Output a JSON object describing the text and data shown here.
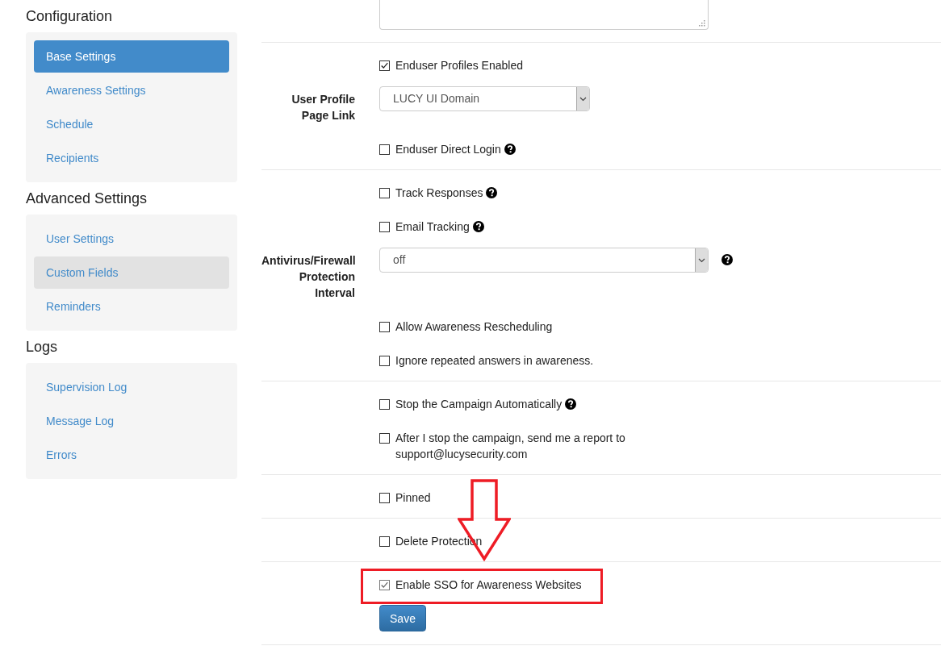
{
  "sidebar": {
    "groups": [
      {
        "title": "Configuration",
        "items": [
          {
            "label": "Base Settings",
            "selected": true,
            "hovered": false
          },
          {
            "label": "Awareness Settings",
            "selected": false,
            "hovered": false
          },
          {
            "label": "Schedule",
            "selected": false,
            "hovered": false
          },
          {
            "label": "Recipients",
            "selected": false,
            "hovered": false
          }
        ]
      },
      {
        "title": "Advanced Settings",
        "items": [
          {
            "label": "User Settings",
            "selected": false,
            "hovered": false
          },
          {
            "label": "Custom Fields",
            "selected": false,
            "hovered": true
          },
          {
            "label": "Reminders",
            "selected": false,
            "hovered": false
          }
        ]
      },
      {
        "title": "Logs",
        "items": [
          {
            "label": "Supervision Log",
            "selected": false,
            "hovered": false
          },
          {
            "label": "Message Log",
            "selected": false,
            "hovered": false
          },
          {
            "label": "Errors",
            "selected": false,
            "hovered": false
          }
        ]
      }
    ]
  },
  "form": {
    "sections": [
      {
        "rows": [
          {
            "kind": "textarea"
          }
        ]
      },
      {
        "rows": [
          {
            "kind": "checkbox",
            "label": "Enduser Profiles Enabled",
            "checked": true,
            "help": false,
            "annotated": false
          },
          {
            "kind": "select",
            "label": "User Profile Page Link",
            "value": "LUCY UI Domain",
            "wide": false,
            "help": false
          },
          {
            "kind": "checkbox",
            "label": "Enduser Direct Login",
            "checked": false,
            "help": true,
            "annotated": false
          }
        ]
      },
      {
        "rows": [
          {
            "kind": "checkbox",
            "label": "Track Responses",
            "checked": false,
            "help": true,
            "annotated": false
          },
          {
            "kind": "checkbox",
            "label": "Email Tracking",
            "checked": false,
            "help": true,
            "annotated": false
          },
          {
            "kind": "select",
            "label": "Antivirus/Firewall Protection Interval",
            "value": "off",
            "wide": true,
            "help": true
          },
          {
            "kind": "checkbox",
            "label": "Allow Awareness Rescheduling",
            "checked": false,
            "help": false,
            "annotated": false
          },
          {
            "kind": "checkbox",
            "label": "Ignore repeated answers in awareness.",
            "checked": false,
            "help": false,
            "annotated": false
          }
        ]
      },
      {
        "rows": [
          {
            "kind": "checkbox",
            "label": "Stop the Campaign Automatically",
            "checked": false,
            "help": true,
            "annotated": false
          },
          {
            "kind": "checkbox",
            "label": "After I stop the campaign, send me a report to support@lucysecurity.com",
            "checked": false,
            "help": false,
            "annotated": false
          }
        ]
      },
      {
        "rows": [
          {
            "kind": "checkbox",
            "label": "Pinned",
            "checked": false,
            "help": false,
            "annotated": false
          }
        ]
      },
      {
        "rows": [
          {
            "kind": "checkbox",
            "label": "Delete Protection",
            "checked": false,
            "help": false,
            "annotated": false
          }
        ]
      },
      {
        "rows": [
          {
            "kind": "checkbox",
            "label": "Enable SSO for Awareness Websites",
            "checked": true,
            "help": false,
            "annotated": true
          },
          {
            "kind": "button",
            "label": "Save"
          }
        ]
      }
    ]
  }
}
